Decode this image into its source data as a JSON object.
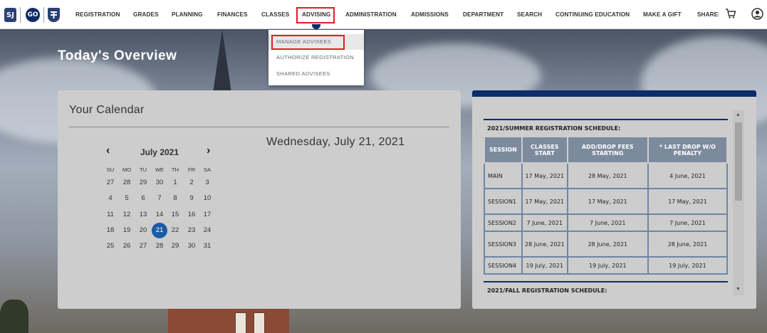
{
  "nav": {
    "logos": [
      "SJ",
      "GO",
      "shield"
    ],
    "items": [
      "REGISTRATION",
      "GRADES",
      "PLANNING",
      "FINANCES",
      "CLASSES",
      "ADVISING",
      "ADMINISTRATION",
      "ADMISSIONS",
      "DEPARTMENT",
      "SEARCH",
      "CONTINUING EDUCATION",
      "MAKE A GIFT",
      "SHAREI"
    ],
    "active": "ADVISING",
    "icons": [
      "cart-icon",
      "user-icon"
    ]
  },
  "dropdown": {
    "items": [
      "MANAGE ADVISEES",
      "AUTHORIZE REGISTRATION",
      "SHARED ADVISEES"
    ],
    "highlighted": "MANAGE ADVISEES"
  },
  "page": {
    "heading": "Today's Overview"
  },
  "calendar": {
    "title": "Your Calendar",
    "month_label": "July 2021",
    "prev_symbol": "‹",
    "next_symbol": "›",
    "weekdays": [
      "SU",
      "MO",
      "TU",
      "WE",
      "TH",
      "FR",
      "SA"
    ],
    "weeks": [
      [
        "27",
        "28",
        "29",
        "30",
        "1",
        "2",
        "3"
      ],
      [
        "4",
        "5",
        "6",
        "7",
        "8",
        "9",
        "10"
      ],
      [
        "11",
        "12",
        "13",
        "14",
        "15",
        "16",
        "17"
      ],
      [
        "18",
        "19",
        "20",
        "21",
        "22",
        "23",
        "24"
      ],
      [
        "25",
        "26",
        "27",
        "28",
        "29",
        "30",
        "31"
      ]
    ],
    "selected_day": "21",
    "selected_date_text": "Wednesday, July 21, 2021",
    "selected_color": "#1d5aa6"
  },
  "schedule": {
    "summer_title": "2021/SUMMER REGISTRATION SCHEDULE:",
    "columns": [
      "SESSION",
      "CLASSES START",
      "ADD/DROP FEES STARTING",
      "* LAST DROP W/O PENALTY"
    ],
    "rows": [
      [
        "MAIN",
        "17 May, 2021",
        "28 May, 2021",
        "4 June, 2021"
      ],
      [
        "SESSION1",
        "17 May, 2021",
        "17 May, 2021",
        "17 May, 2021"
      ],
      [
        "SESSION2",
        "7 June, 2021",
        "7 June, 2021",
        "7 June, 2021"
      ],
      [
        "SESSION3",
        "28 June, 2021",
        "28 June, 2021",
        "28 June, 2021"
      ],
      [
        "SESSION4",
        "19 July, 2021",
        "19 July, 2021",
        "19 July, 2021"
      ]
    ],
    "fall_title": "2021/FALL REGISTRATION SCHEDULE:",
    "header_color": "#7c8a9e",
    "accent_color": "#0d2c6b"
  }
}
